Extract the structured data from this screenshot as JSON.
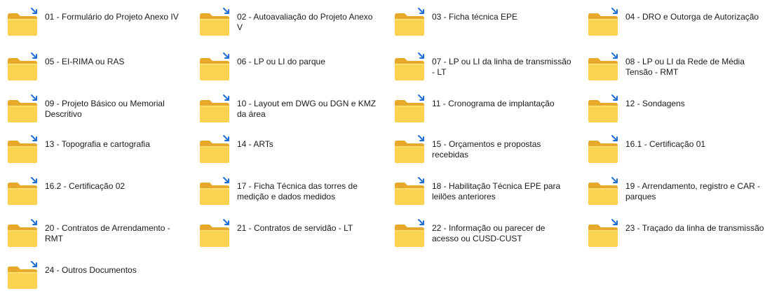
{
  "folders": [
    {
      "name": "01 - Formulário do Projeto Anexo IV"
    },
    {
      "name": "02 - Autoavaliação do Projeto Anexo V"
    },
    {
      "name": "03 - Ficha técnica EPE"
    },
    {
      "name": "04 - DRO e Outorga de Autorização"
    },
    {
      "name": "05 - EI-RIMA ou RAS"
    },
    {
      "name": "06 - LP ou LI do parque"
    },
    {
      "name": "07 - LP ou LI da linha de transmissão - LT"
    },
    {
      "name": "08 - LP ou LI da Rede de Média Tensão - RMT"
    },
    {
      "name": "09 - Projeto Básico ou Memorial Descritivo"
    },
    {
      "name": "10 - Layout em DWG ou DGN e KMZ da área"
    },
    {
      "name": "11 - Cronograma de implantação"
    },
    {
      "name": "12 - Sondagens"
    },
    {
      "name": "13 - Topografia e cartografia"
    },
    {
      "name": "14 - ARTs"
    },
    {
      "name": "15 - Orçamentos e propostas recebidas"
    },
    {
      "name": "16.1 - Certificação 01"
    },
    {
      "name": "16.2 - Certificação 02"
    },
    {
      "name": "17 - Ficha Técnica das torres de medição e dados medidos"
    },
    {
      "name": "18 - Habilitação Técnica EPE para leilões anteriores"
    },
    {
      "name": "19 - Arrendamento, registro e CAR - parques"
    },
    {
      "name": "20 - Contratos de Arrendamento - RMT"
    },
    {
      "name": "21 - Contratos de servidão - LT"
    },
    {
      "name": "22 - Informação ou parecer de acesso ou CUSD-CUST"
    },
    {
      "name": "23 - Traçado da linha de transmissão"
    },
    {
      "name": "24 - Outros Documentos"
    }
  ],
  "icons": {
    "folder": "shortcut-folder-icon"
  },
  "colors": {
    "folder_back": "#e8a92a",
    "folder_front": "#fcd34f",
    "folder_highlight": "#ffe27a",
    "shortcut_arrow": "#1d6fd6",
    "text": "#1a1a1a"
  }
}
